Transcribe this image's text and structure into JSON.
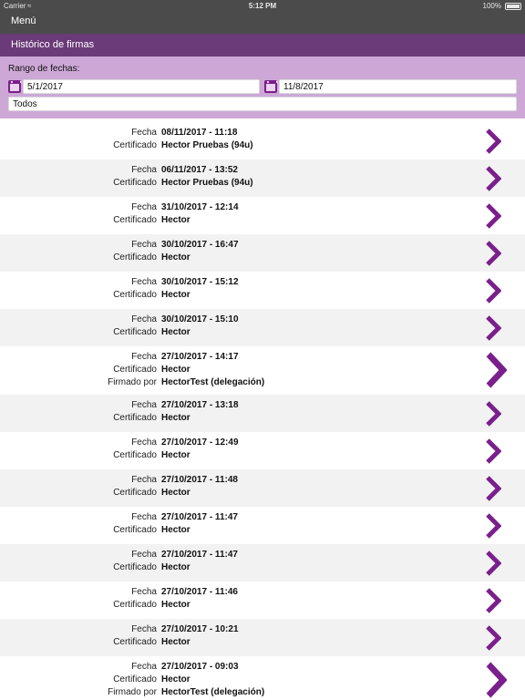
{
  "status_bar": {
    "carrier": "Carrier",
    "time": "5:12 PM",
    "battery": "100%"
  },
  "nav": {
    "menu_label": "Menú"
  },
  "header": {
    "title": "Histórico de firmas"
  },
  "filter": {
    "range_label": "Rango de fechas:",
    "date_from": "5/1/2017",
    "date_to": "11/8/2017",
    "status_value": "Todos"
  },
  "labels": {
    "fecha": "Fecha",
    "certificado": "Certificado",
    "firmado_por": "Firmado por"
  },
  "colors": {
    "accent": "#7a1f8c",
    "header": "#6b3a78",
    "filter_bg": "#cda8d6",
    "navbar": "#4b4b4b"
  },
  "signatures": [
    {
      "fecha": "08/11/2017 - 11:18",
      "certificado": "Hector Pruebas (94u)",
      "firmado_por": null
    },
    {
      "fecha": "06/11/2017 - 13:52",
      "certificado": "Hector Pruebas (94u)",
      "firmado_por": null
    },
    {
      "fecha": "31/10/2017 - 12:14",
      "certificado": "Hector",
      "firmado_por": null
    },
    {
      "fecha": "30/10/2017 - 16:47",
      "certificado": "Hector",
      "firmado_por": null
    },
    {
      "fecha": "30/10/2017 - 15:12",
      "certificado": "Hector",
      "firmado_por": null
    },
    {
      "fecha": "30/10/2017 - 15:10",
      "certificado": "Hector",
      "firmado_por": null
    },
    {
      "fecha": "27/10/2017 - 14:17",
      "certificado": "Hector",
      "firmado_por": "HectorTest (delegación)"
    },
    {
      "fecha": "27/10/2017 - 13:18",
      "certificado": "Hector",
      "firmado_por": null
    },
    {
      "fecha": "27/10/2017 - 12:49",
      "certificado": "Hector",
      "firmado_por": null
    },
    {
      "fecha": "27/10/2017 - 11:48",
      "certificado": "Hector",
      "firmado_por": null
    },
    {
      "fecha": "27/10/2017 - 11:47",
      "certificado": "Hector",
      "firmado_por": null
    },
    {
      "fecha": "27/10/2017 - 11:47",
      "certificado": "Hector",
      "firmado_por": null
    },
    {
      "fecha": "27/10/2017 - 11:46",
      "certificado": "Hector",
      "firmado_por": null
    },
    {
      "fecha": "27/10/2017 - 10:21",
      "certificado": "Hector",
      "firmado_por": null
    },
    {
      "fecha": "27/10/2017 - 09:03",
      "certificado": "Hector",
      "firmado_por": "HectorTest (delegación)"
    }
  ]
}
